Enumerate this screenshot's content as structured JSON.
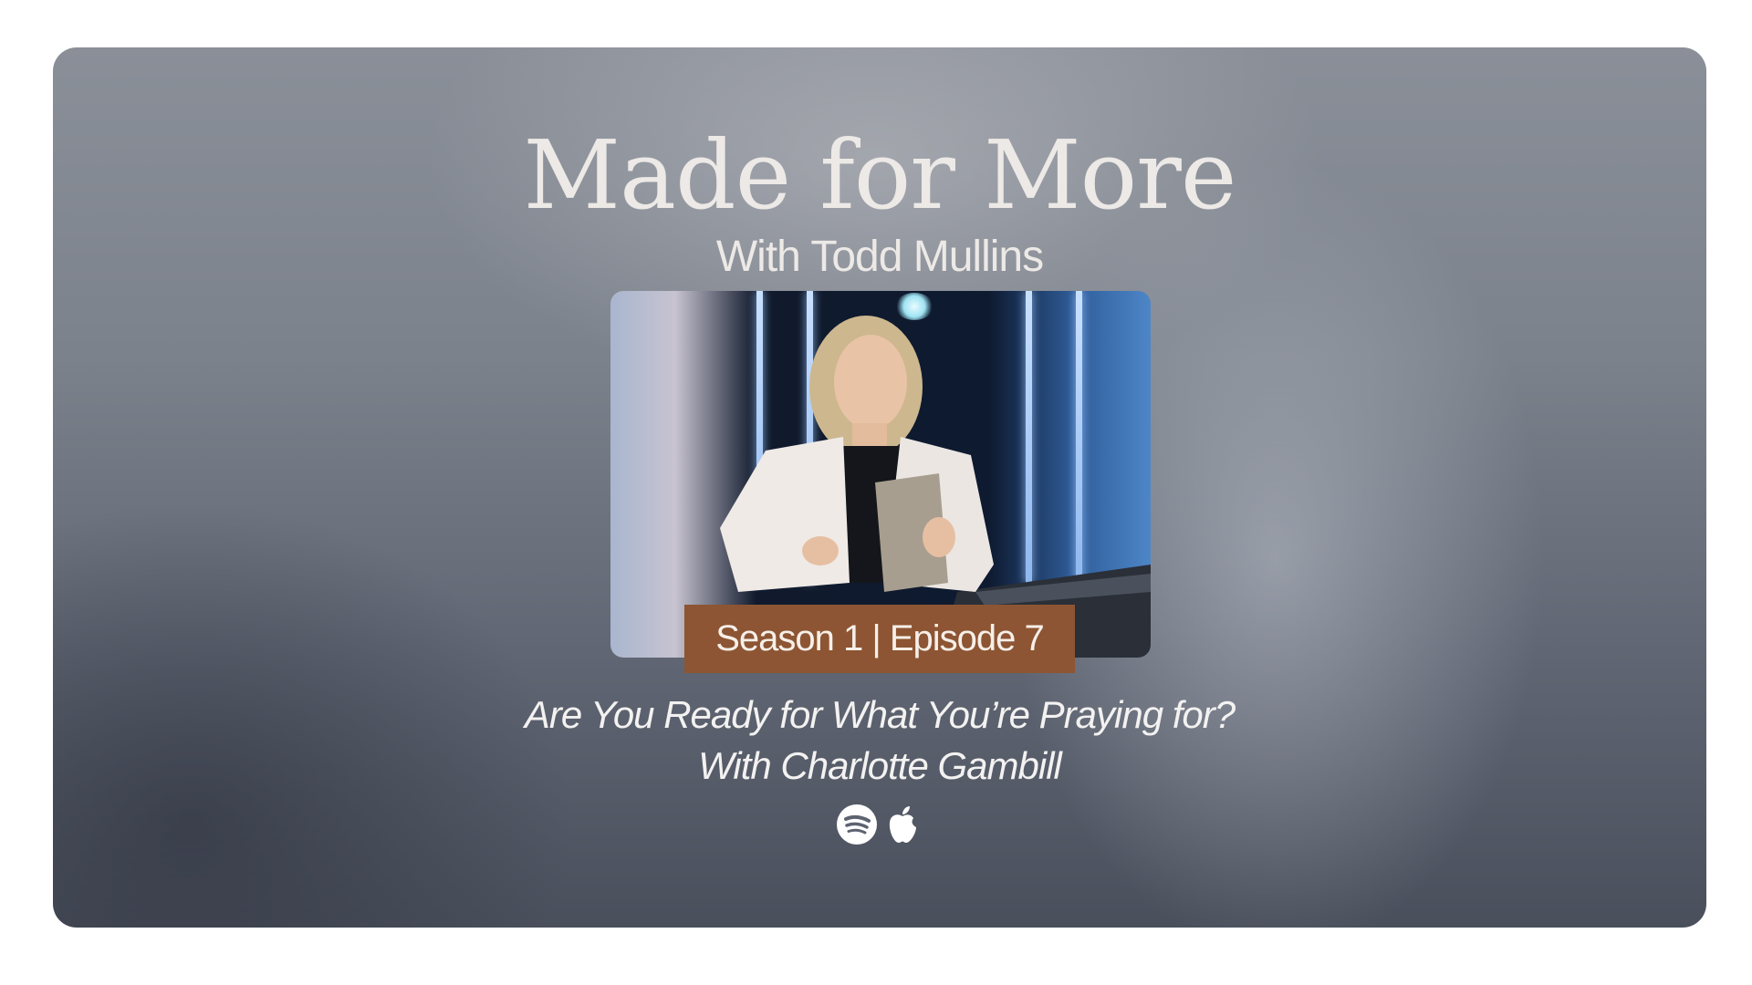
{
  "podcast": {
    "title": "Made for More",
    "host_line": "With Todd Mullins"
  },
  "episode": {
    "badge": "Season 1 | Episode 7",
    "title": "Are You Ready for What You’re Praying for?",
    "guest_line": "With Charlotte Gambill"
  },
  "platforms": [
    {
      "name": "Spotify",
      "icon": "spotify-icon"
    },
    {
      "name": "Apple Podcasts",
      "icon": "apple-icon"
    }
  ],
  "colors": {
    "badge_background": "#8d5533",
    "text": "#ece9e6"
  }
}
